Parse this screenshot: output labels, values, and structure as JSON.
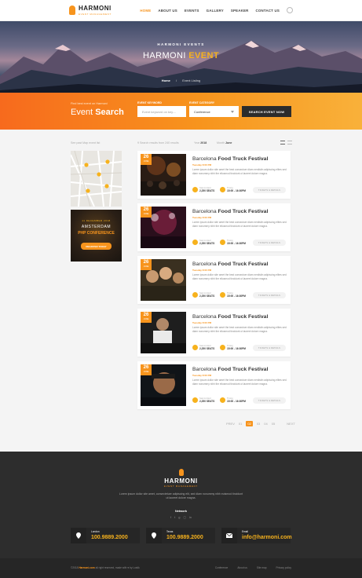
{
  "brand": {
    "name": "HARMONI",
    "tagline": "EVENT MANAGEMENT",
    "accent": "#f7941d",
    "accent_light": "#f7b21d",
    "dark": "#2d2d2d"
  },
  "nav": {
    "items": [
      "HOME",
      "ABOUT US",
      "EVENTS",
      "GALLERY",
      "SPEAKER",
      "CONTACT US"
    ],
    "active": "HOME",
    "search_icon": "search-icon"
  },
  "hero": {
    "kicker": "HARMONI EVENTS",
    "title_plain": "HARMONI",
    "title_accent": "EVENT",
    "breadcrumb": [
      "Home",
      "/",
      "Event Listing"
    ]
  },
  "search": {
    "lead": "Find best event on Harmoni",
    "title_plain": "Event",
    "title_bold": "Search",
    "keyword_label": "EVENT KEYWORD",
    "keyword_placeholder": "Event keyword on key....",
    "category_label": "EVENT CATEGORY",
    "category_value": "Conference",
    "button": "SEARCH EVENT NOW"
  },
  "listing": {
    "filter_hint": "See past Map event list",
    "showing": "9 Search results from 240 results",
    "year_label": "Year",
    "year": "2018",
    "month_label": "Month",
    "month": "June",
    "view_icons": [
      "grid-view-icon",
      "list-view-icon"
    ]
  },
  "promo": {
    "date": "11 DECEMBER 2018",
    "city": "AMSTERDAM",
    "event": "PHP CONFERENCE",
    "button": "REGISTER TODAY"
  },
  "events": [
    {
      "day": "26",
      "month": "JUNE",
      "city": "Barcelona",
      "name": "Food Truck Festival",
      "time": "Tuesday 8:00 PM",
      "desc": "Lorem ipsum dollor site amet the best  consectuer diam nerdistin adipiscing elites sed diam nonummy nibh the eliusmod tincidunt ut laoreet dolore magna.",
      "seats_label": "Seat Limited",
      "seats": "2,250 SEATS",
      "time_label": "Timing",
      "hours": "15:00 - 16:30PM",
      "button": "TICKETS & DETAILS"
    },
    {
      "day": "26",
      "month": "JUNE",
      "city": "Barcelona",
      "name": "Food Truck Festival",
      "time": "Tuesday 8:00 PM",
      "desc": "Lorem ipsum dollor site amet the best  consectuer diam nerdistin adipiscing elites sed diam nonummy nibh the eliusmod tincidunt ut laoreet dolore magna.",
      "seats_label": "Seat Limited",
      "seats": "2,250 SEATS",
      "time_label": "Timing",
      "hours": "15:00 - 16:30PM",
      "button": "TICKETS & DETAILS"
    },
    {
      "day": "26",
      "month": "JUNE",
      "city": "Barcelona",
      "name": "Food Truck Festival",
      "time": "Tuesday 8:00 PM",
      "desc": "Lorem ipsum dollor site amet the best  consectuer diam nerdistin adipiscing elites sed diam nonummy nibh the eliusmod tincidunt ut laoreet dolore magna.",
      "seats_label": "Seat Limited",
      "seats": "2,250 SEATS",
      "time_label": "Timing",
      "hours": "15:00 - 16:30PM",
      "button": "TICKETS & DETAILS"
    },
    {
      "day": "26",
      "month": "JUNE",
      "city": "Barcelona",
      "name": "Food Truck Festival",
      "time": "Tuesday 8:00 PM",
      "desc": "Lorem ipsum dollor site amet the best  consectuer diam nerdistin adipiscing elites sed diam nonummy nibh the eliusmod tincidunt ut laoreet dolore magna.",
      "seats_label": "Seat Limited",
      "seats": "2,250 SEATS",
      "time_label": "Timing",
      "hours": "15:00 - 16:30PM",
      "button": "TICKETS & DETAILS"
    },
    {
      "day": "26",
      "month": "JUNE",
      "city": "Barcelona",
      "name": "Food Truck Festival",
      "time": "Tuesday 8:00 PM",
      "desc": "Lorem ipsum dollor site amet the best  consectuer diam nerdistin adipiscing elites sed diam nonummy nibh the eliusmod tincidunt ut laoreet dolore magna.",
      "seats_label": "Seat Limited",
      "seats": "2,250 SEATS",
      "time_label": "Timing",
      "hours": "15:00 - 16:30PM",
      "button": "TICKETS & DETAILS"
    }
  ],
  "pagination": {
    "prev": "PREV",
    "pages": [
      "01",
      "02",
      "03",
      "04",
      "05"
    ],
    "current": "02",
    "next": "NEXT"
  },
  "footer": {
    "about": "Lorem ipsum dollor site amet, consectetuer adipiscing elit, sed diam nonummy nibh euismod tincidunt ut laoreet dolore magna.",
    "network_label": "Network",
    "social": [
      "facebook-icon",
      "twitter-icon",
      "google-plus-icon",
      "instagram-icon",
      "linkedin-icon"
    ],
    "contacts": [
      {
        "icon": "location-icon",
        "label": "London",
        "value": "100.9889.2000"
      },
      {
        "icon": "location-icon",
        "label": "Texas",
        "value": "100.9889.2000"
      },
      {
        "icon": "mail-icon",
        "label": "Email",
        "value": "info@harmoni.com"
      }
    ],
    "copyright_pre": "©2018 ",
    "copyright_site": "Harmoni.com",
    "copyright_post": " all right reserved, made with ♥ by Lustik",
    "links": [
      "Conference",
      "About us",
      "Site map",
      "Privacy policy"
    ]
  }
}
